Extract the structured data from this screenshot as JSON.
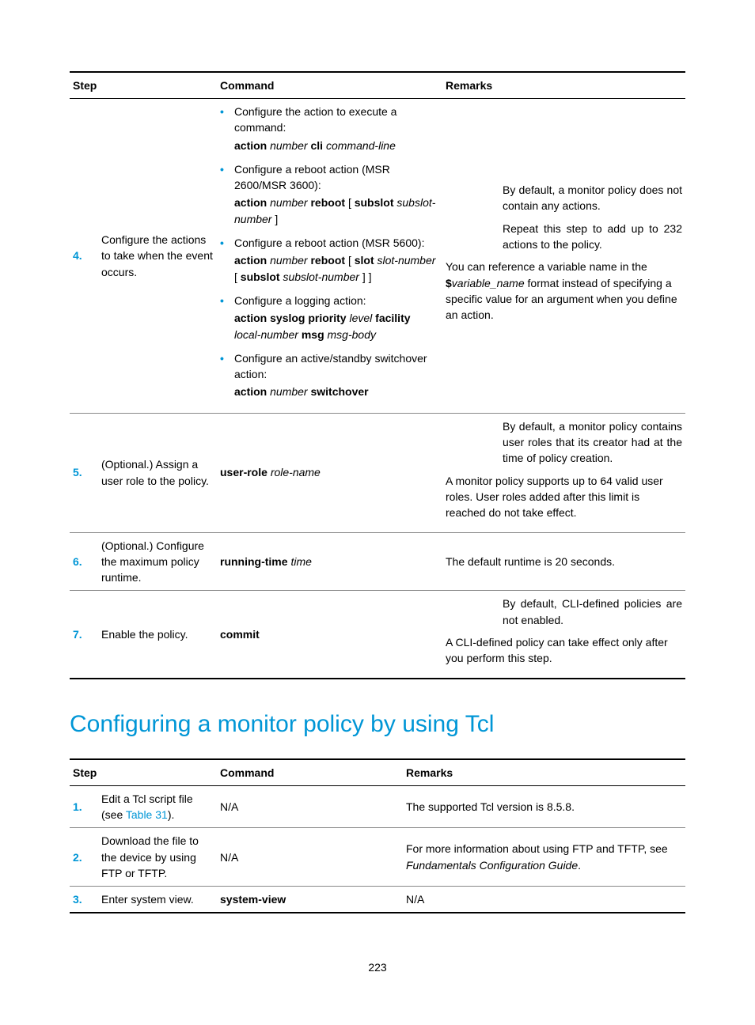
{
  "table1": {
    "headers": {
      "step": "Step",
      "command": "Command",
      "remarks": "Remarks"
    },
    "rows": {
      "r4": {
        "num": "4.",
        "desc": "Configure the actions to take when the event occurs.",
        "cmd": {
          "b1a": "Configure the action to execute a command:",
          "b1b_1": "action",
          "b1b_2": "number",
          "b1b_3": "cli",
          "b1b_4": "command-line",
          "b2a": "Configure a reboot action (MSR 2600/MSR 3600):",
          "b2b_1": "action",
          "b2b_2": "number",
          "b2b_3": "reboot",
          "b2b_4": "[",
          "b2b_5": "subslot",
          "b2b_6": "subslot-number",
          "b2b_7": "]",
          "b3a": "Configure a reboot action (MSR 5600):",
          "b3b_1": "action",
          "b3b_2": "number",
          "b3b_3": "reboot",
          "b3b_4": "[",
          "b3b_5": "slot",
          "b3b_6": "slot-number",
          "b3b_7": "[",
          "b3b_8": "subslot",
          "b3b_9": "subslot-number",
          "b3b_10": "] ]",
          "b4a": "Configure a logging action:",
          "b4b_1": "action syslog priority",
          "b4b_2": "level",
          "b4b_3": "facility",
          "b4b_4": "local-number",
          "b4b_5": "msg",
          "b4b_6": "msg-body",
          "b5a": "Configure an active/standby switchover action:",
          "b5b_1": "action",
          "b5b_2": "number",
          "b5b_3": "switchover"
        },
        "remarks": {
          "p1": "By default, a monitor policy does not contain any actions.",
          "p2": "Repeat this step to add up to 232 actions to the policy.",
          "p3_a": "You can reference a variable name in the ",
          "p3_b": "$",
          "p3_c": "variable_name",
          "p3_d": " format instead of specifying a specific value for an argument when you define an action."
        }
      },
      "r5": {
        "num": "5.",
        "desc": "(Optional.) Assign a user role to the policy.",
        "cmd_1": "user-role",
        "cmd_2": "role-name",
        "remarks": {
          "p1": "By default, a monitor policy contains user roles that its creator had at the time of policy creation.",
          "p2": "A monitor policy supports up to 64 valid user roles. User roles added after this limit is reached do not take effect."
        }
      },
      "r6": {
        "num": "6.",
        "desc": "(Optional.) Configure the maximum policy runtime.",
        "cmd_1": "running-time",
        "cmd_2": "time",
        "remarks": {
          "p1": "The default runtime is 20 seconds."
        }
      },
      "r7": {
        "num": "7.",
        "desc": "Enable the policy.",
        "cmd_1": "commit",
        "remarks": {
          "p1": "By default, CLI-defined policies are not enabled.",
          "p2": "A CLI-defined policy can take effect only after you perform this step."
        }
      }
    }
  },
  "section_heading": "Configuring a monitor policy by using Tcl",
  "table2": {
    "headers": {
      "step": "Step",
      "command": "Command",
      "remarks": "Remarks"
    },
    "rows": {
      "r1": {
        "num": "1.",
        "desc_a": "Edit a Tcl script file (see ",
        "desc_link": "Table 31",
        "desc_b": ").",
        "cmd": "N/A",
        "remarks": "The supported Tcl version is 8.5.8."
      },
      "r2": {
        "num": "2.",
        "desc": "Download the file to the device by using FTP or TFTP.",
        "cmd": "N/A",
        "remarks_a": "For more information about using FTP and TFTP, see ",
        "remarks_i": "Fundamentals Configuration Guide",
        "remarks_b": "."
      },
      "r3": {
        "num": "3.",
        "desc": "Enter system view.",
        "cmd": "system-view",
        "remarks": "N/A"
      }
    }
  },
  "page_number": "223"
}
